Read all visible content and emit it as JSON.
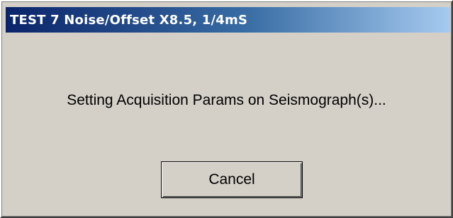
{
  "window": {
    "title": "TEST 7 Noise/Offset X8.5, 1/4mS"
  },
  "dialog": {
    "message": "Setting Acquisition Params on Seismograph(s)...",
    "cancel_label": "Cancel"
  },
  "colors": {
    "titlebar_start": "#0a246a",
    "titlebar_end": "#a6caf0",
    "dialog_background": "#d4d0c8",
    "title_text": "#ffffff"
  }
}
